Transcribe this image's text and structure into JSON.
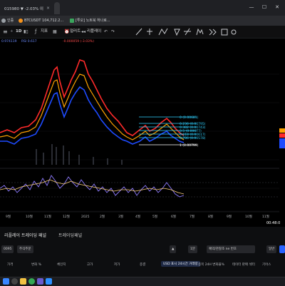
{
  "browser": {
    "tabs": [
      {
        "label": "015980 ▼ -2.03% 이"
      },
      {
        "label": "BTCUSDT 104,712.2..."
      },
      {
        "label": "[투오] 노트북 하나로..."
      }
    ],
    "new_tab": "+",
    "window_controls": {
      "minimize": "—",
      "maximize": "☐",
      "close": "✕"
    }
  },
  "bookmarks": [
    {
      "label": "인증"
    },
    {
      "label": "BTCUSDT 104,712.2..."
    },
    {
      "label": "[투오] 노트북 하나로..."
    }
  ],
  "toolbar": {
    "symbol_add": "+",
    "interval": "1D",
    "indicators_label": "지표",
    "alert_label": "얼러트",
    "replay_label": "리플레이"
  },
  "legend": {
    "line1": "0.974119",
    "line2": "RSI 0.617",
    "line3": "-0.000059 (-3.03%)"
  },
  "chart_data": {
    "type": "line",
    "x_ticks": [
      "9월",
      "10월",
      "11월",
      "12월",
      "2025",
      "2월",
      "3월",
      "4월",
      "5월",
      "6월",
      "7월",
      "8월",
      "9월",
      "10월",
      "11월"
    ],
    "fib_levels": [
      {
        "label": "0 (0.00681)"
      },
      {
        "label": "0.236 (0.00795)"
      },
      {
        "label": "0.382 (0.00743)"
      },
      {
        "label": "0.5 (0.00677)"
      },
      {
        "label": "0.618 (0.00617)"
      },
      {
        "label": "0.786 (0.00578)"
      },
      {
        "label": "1 (0.00799)"
      }
    ],
    "time_readout": "00:48:0",
    "price_colors": {
      "up": "#ff2a2a",
      "down": "#1e4bff",
      "accent": "#ffa200",
      "fib": "#2fd0ff"
    }
  },
  "panel": {
    "tab_active": "리플레이 트레이딩 패널",
    "tab_other": "트레이딩패널",
    "pill_left": "0095",
    "pill_left2": "주식주문",
    "pill_mid1": "▲",
    "pill_mid2": "1분",
    "pill_search": "예약/관찰조 ne 번호",
    "pill_right": "일반",
    "columns": [
      "가격",
      "변화 %",
      "체인지",
      "고가",
      "저가",
      "종결",
      "USD 표시 24시간 거래량",
      "종목 24H 변화율%",
      "테이터 판매 섹터",
      "기어스"
    ]
  },
  "taskbar": {
    "icons": [
      "windows-icon",
      "search-icon",
      "explorer-icon",
      "chrome-icon",
      "app-icon",
      "app-icon-2"
    ]
  }
}
